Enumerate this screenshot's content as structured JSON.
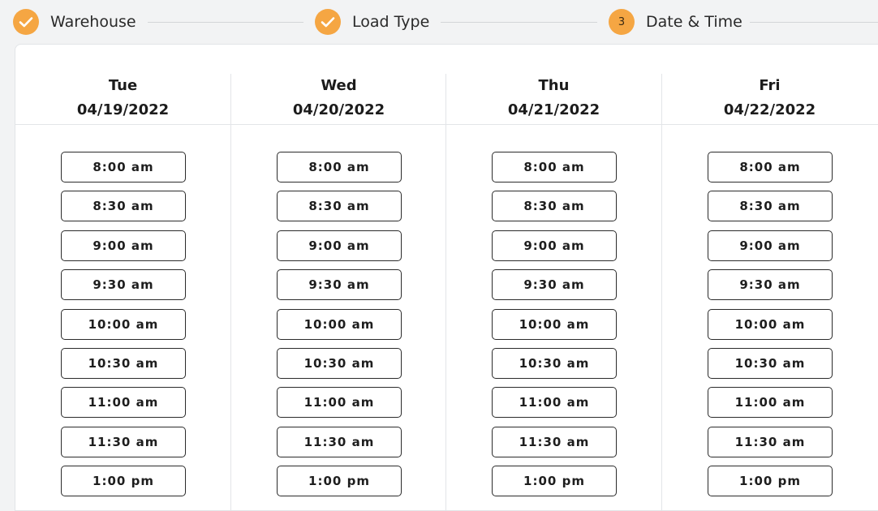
{
  "stepper": {
    "steps": [
      {
        "label": "Warehouse",
        "state": "complete",
        "icon": "check-icon"
      },
      {
        "label": "Load Type",
        "state": "complete",
        "icon": "check-icon"
      },
      {
        "label": "Date & Time",
        "state": "current",
        "number": "3"
      }
    ],
    "accent_color": "#f5a643"
  },
  "schedule": {
    "days": [
      {
        "name": "Tue",
        "date": "04/19/2022",
        "slots": [
          "8:00 am",
          "8:30 am",
          "9:00 am",
          "9:30 am",
          "10:00 am",
          "10:30 am",
          "11:00 am",
          "11:30 am",
          "1:00 pm"
        ]
      },
      {
        "name": "Wed",
        "date": "04/20/2022",
        "slots": [
          "8:00 am",
          "8:30 am",
          "9:00 am",
          "9:30 am",
          "10:00 am",
          "10:30 am",
          "11:00 am",
          "11:30 am",
          "1:00 pm"
        ]
      },
      {
        "name": "Thu",
        "date": "04/21/2022",
        "slots": [
          "8:00 am",
          "8:30 am",
          "9:00 am",
          "9:30 am",
          "10:00 am",
          "10:30 am",
          "11:00 am",
          "11:30 am",
          "1:00 pm"
        ]
      },
      {
        "name": "Fri",
        "date": "04/22/2022",
        "slots": [
          "8:00 am",
          "8:30 am",
          "9:00 am",
          "9:30 am",
          "10:00 am",
          "10:30 am",
          "11:00 am",
          "11:30 am",
          "1:00 pm"
        ]
      }
    ]
  }
}
